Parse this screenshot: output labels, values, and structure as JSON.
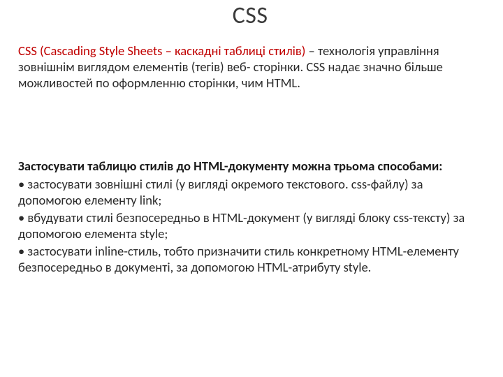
{
  "title": "CSS",
  "intro": {
    "red": "CSS (Cascading Style Sheets – каскадні таблиці стилів)",
    "rest": " – технологія управління зовнішнім виглядом елементів (тегів) веб- сторінки. CSS надає значно більше можливостей по оформленню сторінки, чим HTML."
  },
  "methods": {
    "lead": "Застосувати таблицю стилів до HTML-документу можна трьома способами:",
    "items": [
      " • застосувати зовнішні стилі (у вигляді окремого текстового. css-файлу) за допомогою елементу link;",
      " • вбудувати стилі безпосередньо в HTML-документ (у вигляді блоку css-тексту) за допомогою елемента style;",
      " • застосувати inline-стиль, тобто призначити стиль конкретному HTML-елементу безпосередньо в документі, за допомогою HTML-атрибуту style."
    ]
  }
}
